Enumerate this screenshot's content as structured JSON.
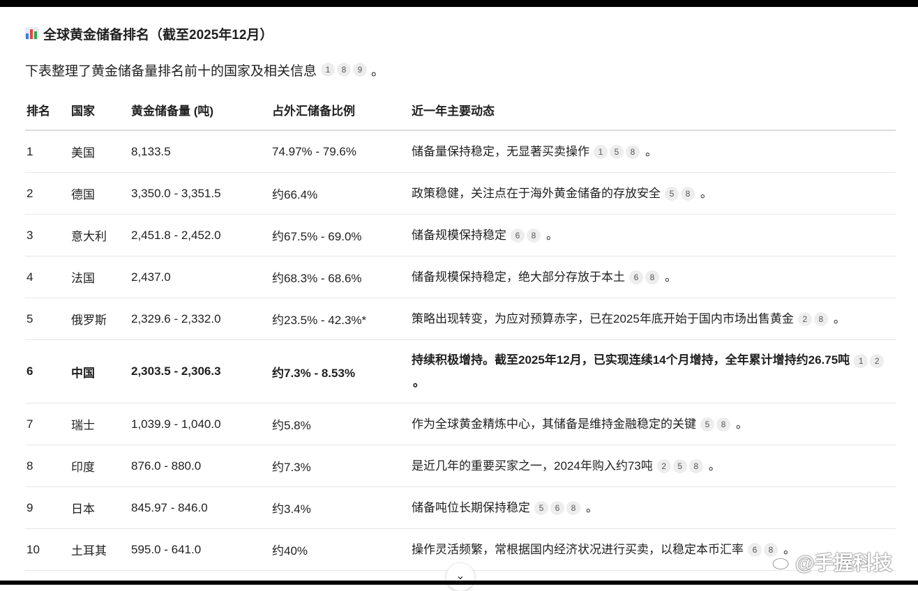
{
  "heading": {
    "icon": "bar-chart-icon",
    "text": "全球黄金储备排名（截至2025年12月）"
  },
  "intro": {
    "text": "下表整理了黄金储备量排名前十的国家及相关信息",
    "cites": [
      "1",
      "8",
      "9"
    ],
    "end": "。"
  },
  "table": {
    "headers": [
      "排名",
      "国家",
      "黄金储备量 (吨)",
      "占外汇储备比例",
      "近一年主要动态"
    ],
    "rows": [
      {
        "rank": "1",
        "country": "美国",
        "reserve": "8,133.5",
        "ratio": "74.97% - 79.6%",
        "note": "储备量保持稳定，无显著买卖操作",
        "cites": [
          "1",
          "5",
          "8"
        ],
        "end": "。"
      },
      {
        "rank": "2",
        "country": "德国",
        "reserve": "3,350.0 - 3,351.5",
        "ratio": "约66.4%",
        "note": "政策稳健，关注点在于海外黄金储备的存放安全",
        "cites": [
          "5",
          "8"
        ],
        "end": "。"
      },
      {
        "rank": "3",
        "country": "意大利",
        "reserve": "2,451.8 - 2,452.0",
        "ratio": "约67.5% - 69.0%",
        "note": "储备规模保持稳定",
        "cites": [
          "6",
          "8"
        ],
        "end": "。"
      },
      {
        "rank": "4",
        "country": "法国",
        "reserve": "2,437.0",
        "ratio": "约68.3% - 68.6%",
        "note": "储备规模保持稳定，绝大部分存放于本土",
        "cites": [
          "6",
          "8"
        ],
        "end": "。"
      },
      {
        "rank": "5",
        "country": "俄罗斯",
        "reserve": "2,329.6 - 2,332.0",
        "ratio": "约23.5% - 42.3%*",
        "note": "策略出现转变，为应对预算赤字，已在2025年底开始于国内市场出售黄金",
        "cites": [
          "2",
          "8"
        ],
        "end": "。"
      },
      {
        "rank": "6",
        "country": "中国",
        "reserve": "2,303.5 - 2,306.3",
        "ratio": "约7.3% - 8.53%",
        "note": "持续积极增持。截至2025年12月，已实现连续14个月增持，全年累计增持约26.75吨",
        "cites": [
          "1",
          "2"
        ],
        "end": "。"
      },
      {
        "rank": "7",
        "country": "瑞士",
        "reserve": "1,039.9 - 1,040.0",
        "ratio": "约5.8%",
        "note": "作为全球黄金精炼中心，其储备是维持金融稳定的关键",
        "cites": [
          "5",
          "8"
        ],
        "end": "。"
      },
      {
        "rank": "8",
        "country": "印度",
        "reserve": "876.0 - 880.0",
        "ratio": "约7.3%",
        "note": "是近几年的重要买家之一，2024年购入约73吨",
        "cites": [
          "2",
          "5",
          "8"
        ],
        "end": "。"
      },
      {
        "rank": "9",
        "country": "日本",
        "reserve": "845.97 - 846.0",
        "ratio": "约3.4%",
        "note": "储备吨位长期保持稳定",
        "cites": [
          "5",
          "6",
          "8"
        ],
        "end": "。"
      },
      {
        "rank": "10",
        "country": "土耳其",
        "reserve": "595.0 - 641.0",
        "ratio": "约40%",
        "note": "操作灵活频繁，常根据国内经济状况进行买卖，以稳定本币汇率",
        "cites": [
          "6",
          "8"
        ],
        "end": "。"
      }
    ]
  },
  "scroll_button": {
    "icon": "chevron-down-icon",
    "glyph": "⌄"
  },
  "watermark": {
    "icon": "weibo-logo-icon",
    "text": "@手握科技"
  }
}
